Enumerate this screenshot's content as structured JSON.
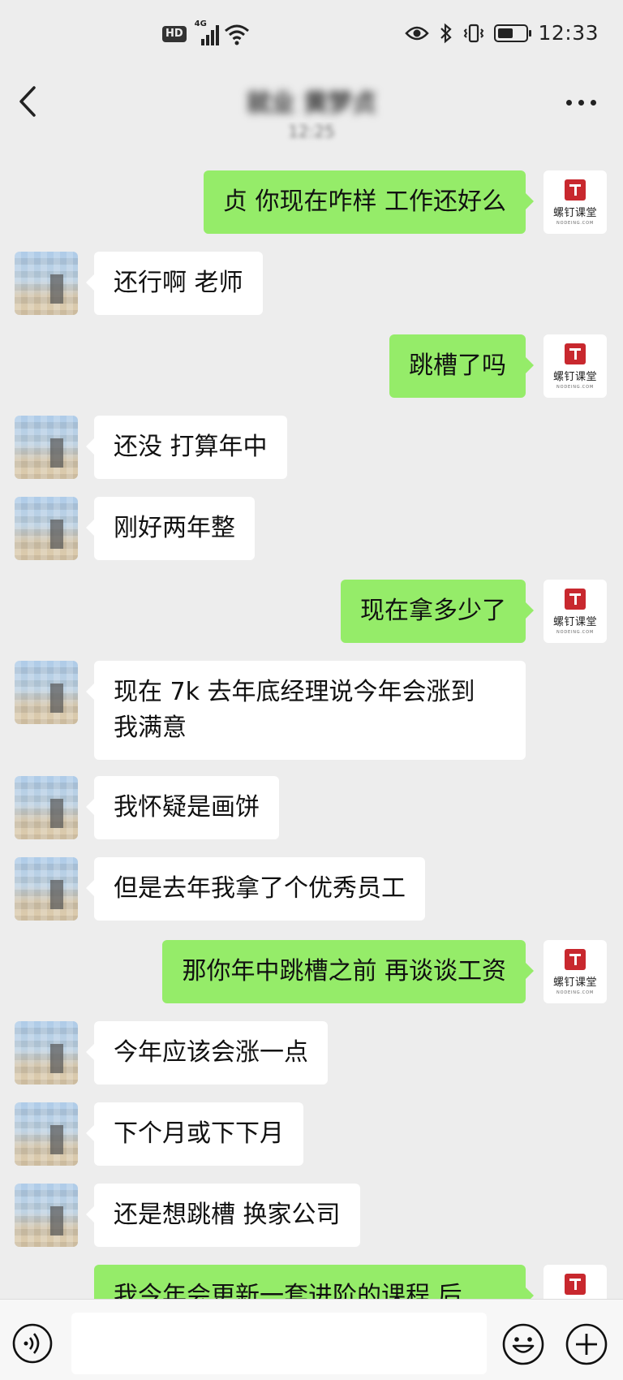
{
  "status_bar": {
    "hd": "HD",
    "network": "4G",
    "time": "12:33",
    "battery_level": 0.55
  },
  "nav": {
    "title": "就业 黄梦贞"
  },
  "timestamp": "12:25",
  "teacher_avatar": {
    "name": "螺钉课堂",
    "sub": "NODEING.COM"
  },
  "messages": [
    {
      "side": "out",
      "text": "  贞 你现在咋样 工作还好么",
      "blurred_prefix": "",
      "text_after": ""
    },
    {
      "side": "in",
      "text": "还行啊 老师"
    },
    {
      "side": "out",
      "text": "跳槽了吗"
    },
    {
      "side": "in",
      "text": "还没 打算年中"
    },
    {
      "side": "in",
      "text": "刚好两年整"
    },
    {
      "side": "out",
      "text": "现在拿多少了"
    },
    {
      "side": "in",
      "text_line1": "现在 7k 去年底经理说今年会涨到",
      "text_line2": "我满意"
    },
    {
      "side": "in",
      "text": "我怀疑是画饼"
    },
    {
      "side": "in",
      "text": "但是去年我拿了个优秀员工"
    },
    {
      "side": "out",
      "text": "那你年中跳槽之前 再谈谈工资"
    },
    {
      "side": "in",
      "text": "今年应该会涨一点"
    },
    {
      "side": "in",
      "text": "下个月或下下月"
    },
    {
      "side": "in",
      "text": "还是想跳槽 换家公司"
    },
    {
      "side": "out",
      "text": "我今年会更新一套进阶的课程 后"
    }
  ],
  "colors": {
    "background": "#ededed",
    "bubble_out": "#95ec69",
    "bubble_in": "#ffffff",
    "logo_red": "#c8282e"
  },
  "input": {
    "placeholder": ""
  }
}
